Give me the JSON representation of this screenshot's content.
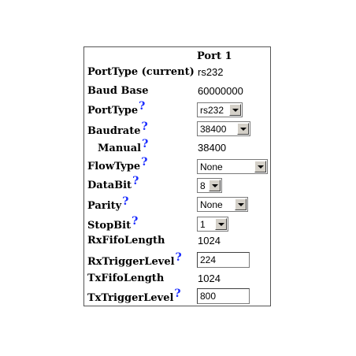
{
  "table": {
    "column_header": "Port 1",
    "rows": {
      "porttype_current": {
        "label": "PortType (current)",
        "value": "rs232"
      },
      "baud_base": {
        "label": "Baud Base",
        "value": "60000000"
      },
      "porttype": {
        "label": "PortType",
        "selected": "rs232"
      },
      "baudrate": {
        "label": "Baudrate",
        "selected": "38400"
      },
      "manual": {
        "label": "Manual",
        "value": "38400"
      },
      "flowtype": {
        "label": "FlowType",
        "selected": "None"
      },
      "databit": {
        "label": "DataBit",
        "selected": "8"
      },
      "parity": {
        "label": "Parity",
        "selected": "None"
      },
      "stopbit": {
        "label": "StopBit",
        "selected": "1"
      },
      "rxfifolength": {
        "label": "RxFifoLength",
        "value": "1024"
      },
      "rxtriggerlevel": {
        "label": "RxTriggerLevel",
        "input_value": "224"
      },
      "txfifolength": {
        "label": "TxFifoLength",
        "value": "1024"
      },
      "txtriggerlevel": {
        "label": "TxTriggerLevel",
        "input_value": "800"
      }
    }
  },
  "help_glyph": "?",
  "icons": {
    "help": "question-mark-icon",
    "dropdown": "chevron-down-icon"
  },
  "colors": {
    "help": "#1a2cff",
    "border": "#555555",
    "button_face": "#d4d0c8"
  }
}
